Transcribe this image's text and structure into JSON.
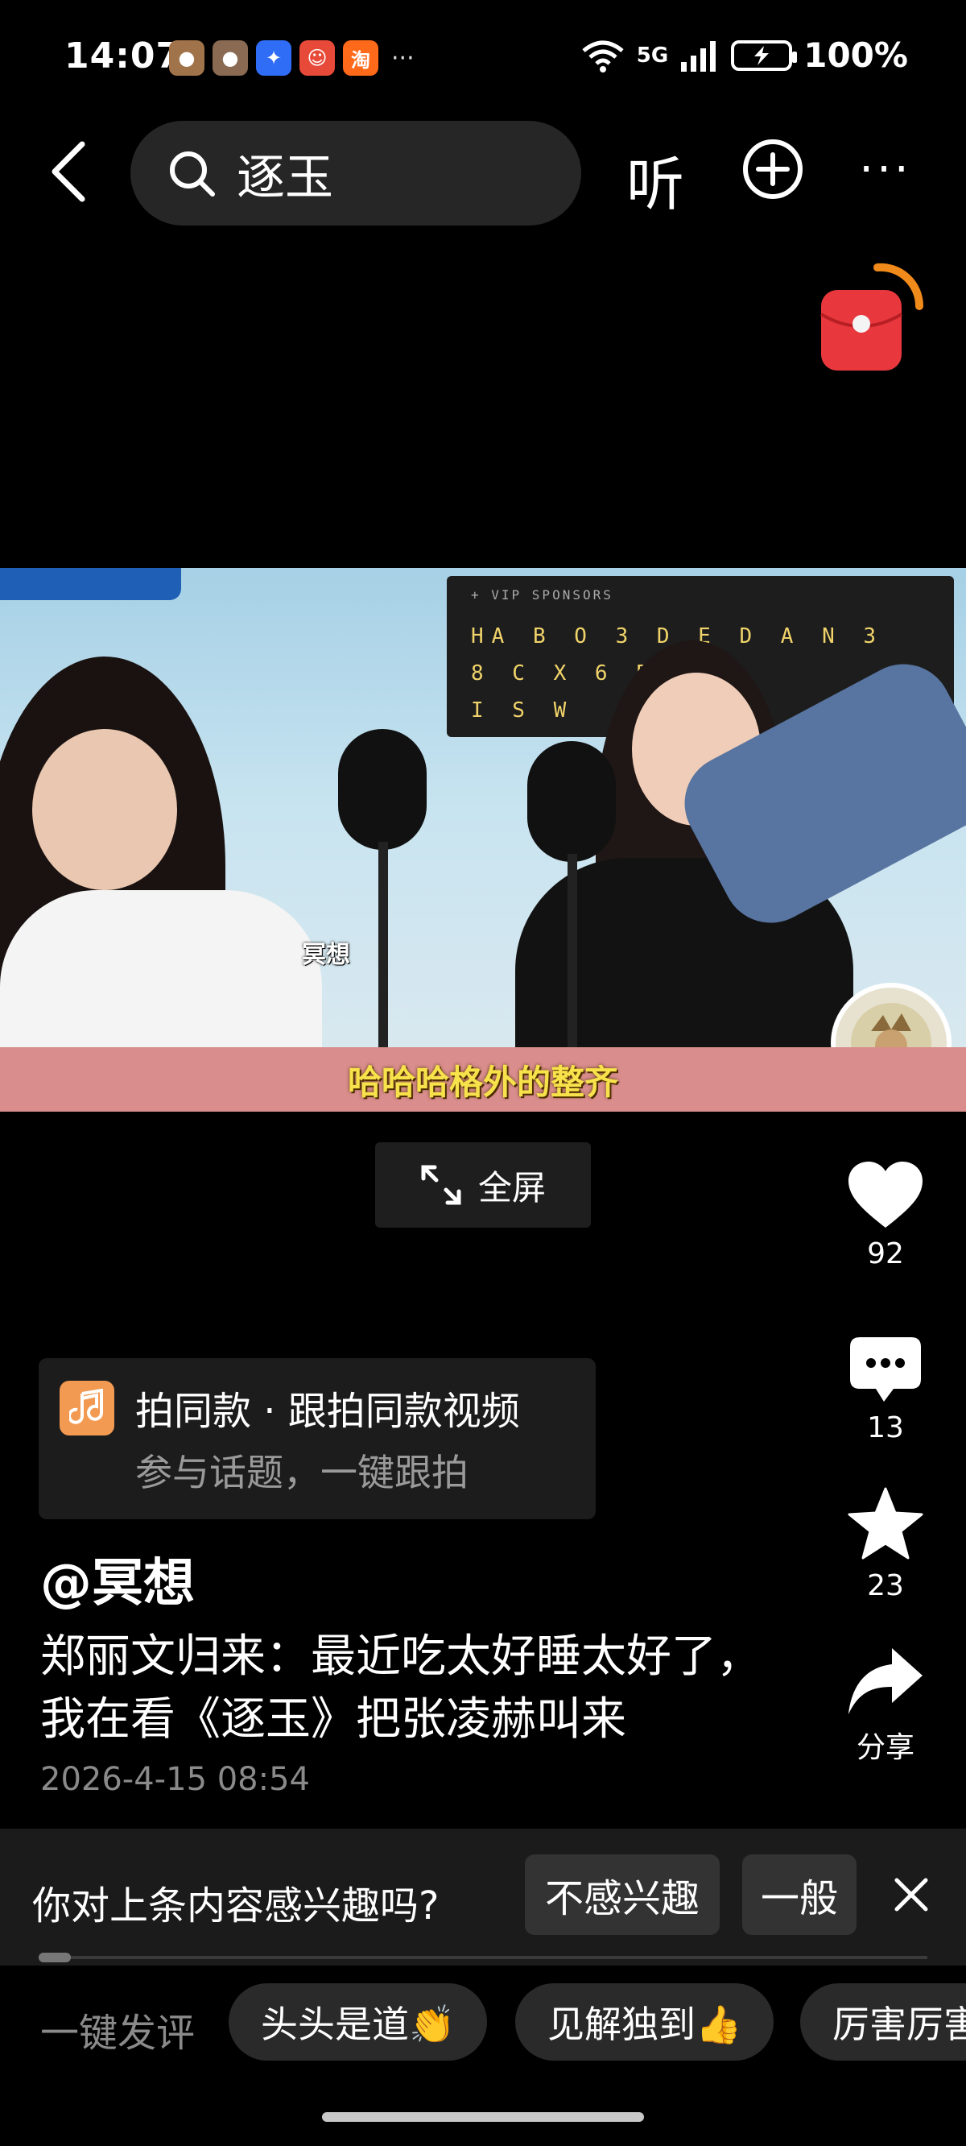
{
  "status_bar": {
    "time": "14:07",
    "more": "···",
    "network": "5G",
    "battery": "100%",
    "notif_icons": [
      {
        "name": "app-avatar-1-icon",
        "color": "#a0734a",
        "glyph": "●"
      },
      {
        "name": "app-avatar-2-icon",
        "color": "#8a6a52",
        "glyph": "●"
      },
      {
        "name": "tencent-docs-icon",
        "color": "#2f6df6",
        "glyph": "✦"
      },
      {
        "name": "clown-app-icon",
        "color": "#e84a3a",
        "glyph": "☺"
      },
      {
        "name": "taobao-icon",
        "color": "#ff6a1a",
        "glyph": "淘"
      }
    ]
  },
  "top_nav": {
    "search_text": "逐玉",
    "listen_label": "听",
    "more_label": "···"
  },
  "video": {
    "subtitle": "哈哈哈格外的整齐",
    "watermark": "冥想",
    "sponsor_rows": [
      "HA B O 3 D E D A N 3",
      "8 C X 6 B T B",
      "I S W"
    ],
    "sponsor_header": "+ VIP SPONSORS"
  },
  "fullscreen_label": "全屏",
  "actions": {
    "likes": "92",
    "comments": "13",
    "favorites": "23",
    "share_label": "分享"
  },
  "same_style": {
    "title": "拍同款 · 跟拍同款视频",
    "subtitle": "参与话题，一键跟拍"
  },
  "post": {
    "author": "@冥想",
    "description": "郑丽文归来：最近吃太好睡太好了，我在看《逐玉》把张凌赫叫来",
    "date": "2026-4-15 08:54"
  },
  "interest": {
    "question": "你对上条内容感兴趣吗?",
    "not_interested": "不感兴趣",
    "average": "一般"
  },
  "quick_comments": {
    "label": "一键发评",
    "chips": [
      "头头是道👏",
      "见解独到👍",
      "厉害厉害"
    ]
  },
  "colors": {
    "background": "#000000",
    "subtitle_bar": "#d98d8d",
    "subtitle_text": "#f7e24b",
    "music_icon": "#f39a52",
    "red_packet": "#e8383d"
  }
}
